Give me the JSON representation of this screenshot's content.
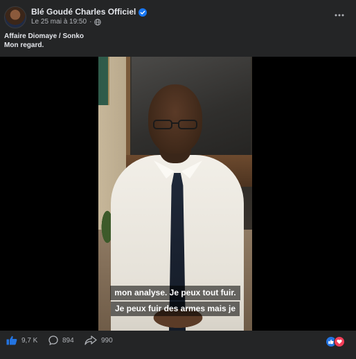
{
  "post": {
    "author": "Blé Goudé Charles Officiel",
    "timestamp": "Le 25 mai à 19:50",
    "audience_icon": "globe-icon",
    "caption_line1": "Affaire Diomaye / Sonko",
    "caption_line2": "Mon regard."
  },
  "video": {
    "subtitle_line1": "mon analyse. Je peux tout fuir.",
    "subtitle_line2": "Je peux fuir des armes mais je"
  },
  "stats": {
    "likes": "9,7 K",
    "comments": "894",
    "shares": "990"
  },
  "colors": {
    "background": "#242526",
    "text_primary": "#e4e6eb",
    "text_secondary": "#b0b3b8",
    "like_blue": "#2374e1",
    "love_red": "#f33e58",
    "verified_blue": "#1877f2"
  }
}
